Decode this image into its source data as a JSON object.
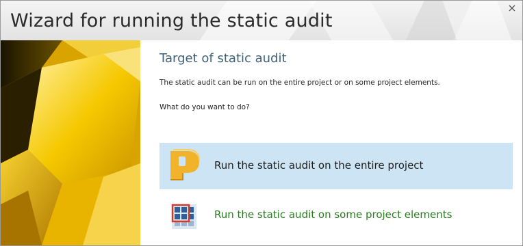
{
  "window": {
    "title": "Wizard for running the static audit",
    "close_glyph": "×"
  },
  "main": {
    "heading": "Target of static audit",
    "description": "The static audit can be run on the entire project or on some project elements.",
    "question": "What do you want to do?",
    "options": [
      {
        "label": "Run the static audit on the entire project",
        "icon": "project-p-icon",
        "selected": true
      },
      {
        "label": "Run the static audit on some project elements",
        "icon": "elements-grid-icon",
        "selected": false
      }
    ]
  },
  "colors": {
    "heading": "#3f6178",
    "selected_option_bg": "#cce4f3",
    "second_option_text": "#2a7d1f",
    "sidebar_yellow": "#e8b400"
  }
}
